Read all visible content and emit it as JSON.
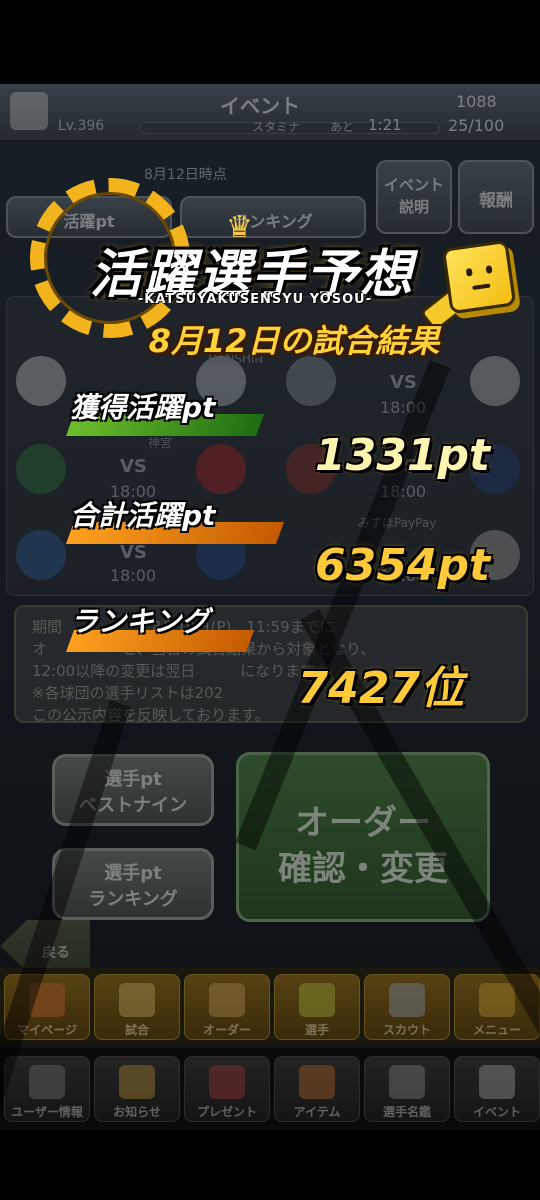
{
  "header": {
    "title": "イベント",
    "coins": "1088",
    "level": "Lv.396",
    "stamina_label": "スタミナ",
    "stamina_wait_label": "あと",
    "stamina_timer": "1:21",
    "stamina_value": "25/100"
  },
  "background": {
    "date_caption": "8月12日時点",
    "event_info_button": "イベント\n説明",
    "reward_button": "報酬",
    "tab_left": "活躍pt",
    "tab_right": "ランキング",
    "matchups": [
      {
        "stadium": "",
        "time": "18:00"
      },
      {
        "stadium": "HANSHIN",
        "time": "18:00"
      },
      {
        "stadium": "神宮",
        "time": "18:00"
      },
      {
        "stadium": "",
        "time": "18:00"
      },
      {
        "stadium": "",
        "time": "18:00"
      },
      {
        "stadium": "みずほPayPay",
        "time": "18:00"
      }
    ],
    "vs_label": "VS",
    "notice_text": "期間　　　　　　8月19日(P)、11:59までに\nオ　　　　　と、当日の試合結果から対象となり、\n12:00以降の変更は翌日　　　になります。\n※各球団の選手リストは202　　　　　　\nこの公示内容を反映しております。",
    "btn_best_nine": "選手pt\nベストナイン",
    "btn_ranking": "選手pt\nランキング",
    "btn_order": "オーダー\n確認・変更",
    "btn_back": "戻る",
    "menu_row1": [
      "マイページ",
      "試合",
      "オーダー",
      "選手",
      "スカウト",
      "メニュー"
    ],
    "menu_row2": [
      "ユーザー情報",
      "お知らせ",
      "プレゼント",
      "アイテム",
      "選手名鑑",
      "イベント"
    ]
  },
  "popup": {
    "title": "活躍選手予想",
    "subtitle": "-KATSUYAKUSENSYU YOSOU-",
    "result_title": "8月12日の試合結果",
    "gained_label": "獲得活躍pt",
    "gained_value": "1331pt",
    "total_label": "合計活躍pt",
    "total_value": "6354pt",
    "ranking_label": "ランキング",
    "ranking_value": "7427位"
  },
  "colors": {
    "gold": "#f2b31c",
    "green_strip": "#6cbf2b",
    "orange_strip": "#ffa11f"
  }
}
